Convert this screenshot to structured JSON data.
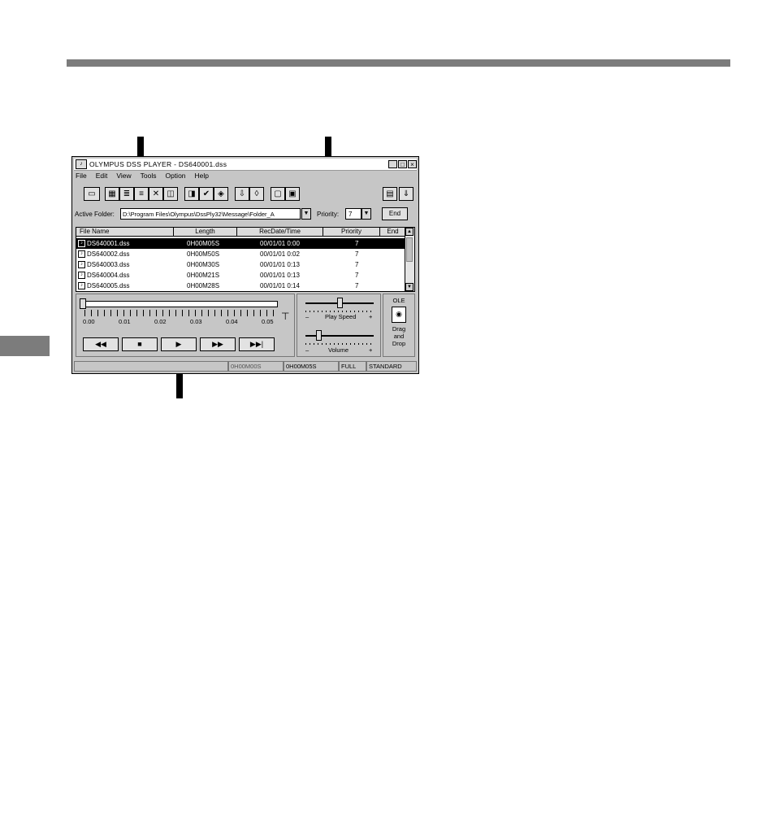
{
  "window": {
    "title": "OLYMPUS DSS PLAYER  -  DS640001.dss",
    "controls": [
      "_",
      "□",
      "×"
    ]
  },
  "menu": [
    "File",
    "Edit",
    "View",
    "Tools",
    "Option",
    "Help"
  ],
  "folder": {
    "label": "Active Folder:",
    "path": "D:\\Program Files\\Olympus\\DssPly32\\Message\\Folder_A",
    "priority_label": "Priority:",
    "priority_value": "7",
    "end_label": "End"
  },
  "table": {
    "columns": [
      "File Name",
      "Length",
      "RecDate/Time",
      "Priority",
      "End"
    ],
    "rows": [
      {
        "name": "DS640001.dss",
        "length": "0H00M05S",
        "recdate": "00/01/01 0:00",
        "priority": "7"
      },
      {
        "name": "DS640002.dss",
        "length": "0H00M50S",
        "recdate": "00/01/01 0:02",
        "priority": "7"
      },
      {
        "name": "DS640003.dss",
        "length": "0H00M30S",
        "recdate": "00/01/01 0:13",
        "priority": "7"
      },
      {
        "name": "DS640004.dss",
        "length": "0H00M21S",
        "recdate": "00/01/01 0:13",
        "priority": "7"
      },
      {
        "name": "DS640005.dss",
        "length": "0H00M28S",
        "recdate": "00/01/01 0:14",
        "priority": "7"
      }
    ],
    "selected_index": 0
  },
  "timeline": {
    "labels": [
      "0.00",
      "0.01",
      "0.02",
      "0.03",
      "0.04",
      "0.05"
    ]
  },
  "transport": {
    "rewind": "◀◀",
    "stop": "■",
    "play": "▶",
    "fast_forward": "▶▶",
    "skip_end": "▶▶|"
  },
  "sliders": {
    "speed_label": "Play Speed",
    "volume_label": "Volume",
    "minus": "–",
    "plus": "+",
    "speed_level": 0.5,
    "volume_level": 0.2
  },
  "ole": {
    "title": "OLE",
    "drag_line1": "Drag",
    "drag_line2": "and",
    "drag_line3": "Drop"
  },
  "status": {
    "position": "0H00M00S",
    "length": "0H00M05S",
    "mode": "FULL",
    "quality": "STANDARD"
  }
}
